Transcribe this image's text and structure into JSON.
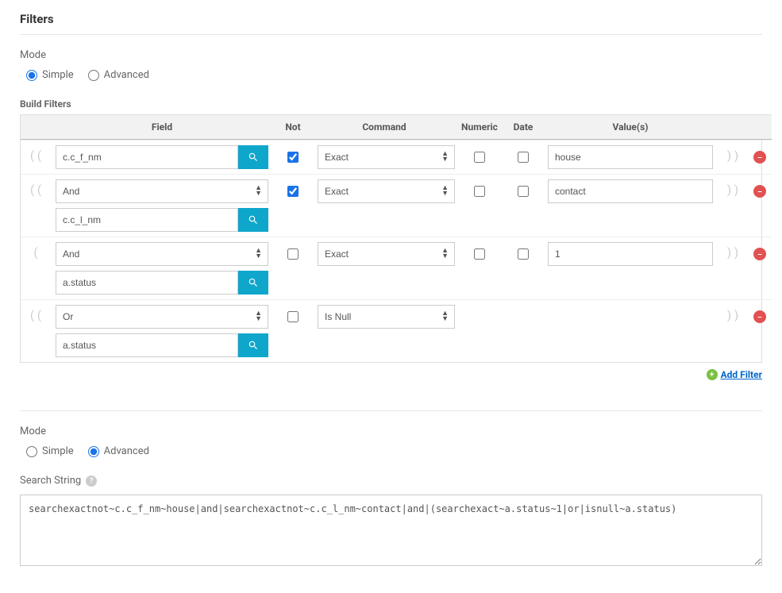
{
  "section_title": "Filters",
  "mode1": {
    "label": "Mode",
    "simple": "Simple",
    "advanced": "Advanced"
  },
  "build_label": "Build Filters",
  "headers": {
    "field": "Field",
    "not": "Not",
    "command": "Command",
    "numeric": "Numeric",
    "date": "Date",
    "values": "Value(s)"
  },
  "rows": [
    {
      "open": "( (",
      "combiner": null,
      "field": "c.c_f_nm",
      "not": true,
      "command": "Exact",
      "numeric": false,
      "date": false,
      "value": "house",
      "close": ") )"
    },
    {
      "open": "( (",
      "combiner": "And",
      "field": "c.c_l_nm",
      "not": true,
      "command": "Exact",
      "numeric": false,
      "date": false,
      "value": "contact",
      "close": ") )"
    },
    {
      "open": "(",
      "combiner": "And",
      "field": "a.status",
      "not": false,
      "command": "Exact",
      "numeric": false,
      "date": false,
      "value": "1",
      "close": ") )"
    },
    {
      "open": "( (",
      "combiner": "Or",
      "field": "a.status",
      "not": false,
      "command": "Is Null",
      "numeric": null,
      "date": null,
      "value": null,
      "close": ") )"
    }
  ],
  "add_filter_label": "Add Filter",
  "mode2": {
    "label": "Mode",
    "simple": "Simple",
    "advanced": "Advanced"
  },
  "search_string_label": "Search String",
  "search_string_value": "searchexactnot~c.c_f_nm~house|and|searchexactnot~c.c_l_nm~contact|and|(searchexact~a.status~1|or|isnull~a.status)"
}
